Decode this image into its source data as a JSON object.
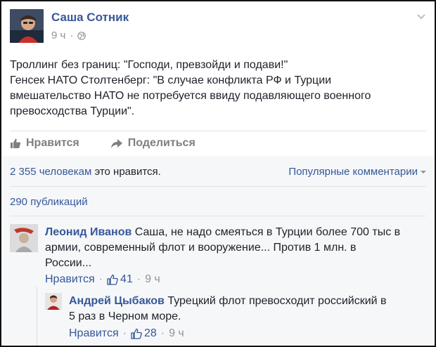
{
  "post": {
    "author": "Саша Сотник",
    "time": "9 ч",
    "lines": [
      "Троллинг без границ: \"Господи, превзойди и подави!\"",
      "Генсек НАТО Столтенберг: \"В случае конфликта РФ и Турции",
      "вмешательство НАТО не потребуется ввиду подавляющего военного",
      "превосходства Турции\"."
    ]
  },
  "actions": {
    "like": "Нравится",
    "share": "Поделиться"
  },
  "stats": {
    "likes_link": "2 355 человекам",
    "likes_suffix": " это нравится.",
    "popular_comments": "Популярные комментарии",
    "shares": "290 публикаций"
  },
  "comments": [
    {
      "name": "Леонид Иванов",
      "text_line1": " Саша, не надо смеяться в Турции более 700 тыс в",
      "text_line2": "армии, современный флот и вооружение... Против 1 млн. в",
      "text_line3": "России...",
      "like_label": "Нравится",
      "sep": "·",
      "like_count": "41",
      "time": "9 ч"
    },
    {
      "name": "Андрей Цыбаков",
      "text_line1": " Турецкий флот превосходит российский в",
      "text_line2": "5 раз в Черном море.",
      "like_label": "Нравится",
      "sep": "·",
      "like_count": "28",
      "time": "9 ч"
    }
  ],
  "colors": {
    "link": "#365899",
    "muted": "#90949c",
    "action": "#7f7f7f",
    "footer_bg": "#f6f7f9"
  }
}
